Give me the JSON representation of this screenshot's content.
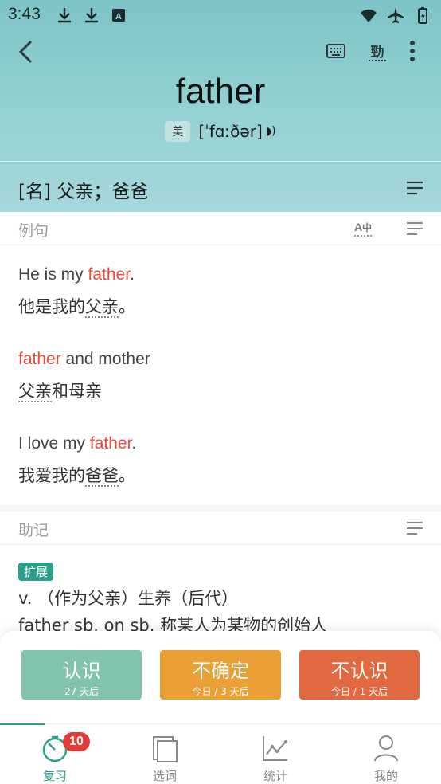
{
  "status": {
    "time": "3:43"
  },
  "word": {
    "text": "father",
    "region": "美",
    "phonetic": "[ˈfɑːðər]"
  },
  "definition": "[名] 父亲；爸爸",
  "examples_section": {
    "title": "例句",
    "items": [
      {
        "en_pre": "He is my ",
        "en_hl": "father",
        "en_post": ".",
        "zh_pre": "他是我的",
        "zh_u": "父亲",
        "zh_post": "。"
      },
      {
        "en_pre": "",
        "en_hl": "father",
        "en_post": " and mother",
        "zh_pre": "",
        "zh_u": "父亲",
        "zh_post": "和母亲"
      },
      {
        "en_pre": "I love my ",
        "en_hl": "father",
        "en_post": ".",
        "zh_pre": "我爱我的",
        "zh_u": "爸爸",
        "zh_post": "。"
      }
    ]
  },
  "mnemonic_section": {
    "title": "助记",
    "tag": "扩展",
    "line1": "v. （作为父亲）生养（后代）",
    "line2": "father sb. on sb. 称某人为某物的创始人"
  },
  "actions": {
    "know": {
      "label": "认识",
      "sub": "27 天后",
      "color": "#82c3ad"
    },
    "unsure": {
      "label": "不确定",
      "sub": "今日 / 3 天后",
      "color": "#eba036"
    },
    "unknown": {
      "label": "不认识",
      "sub": "今日 / 1 天后",
      "color": "#e2693f"
    }
  },
  "nav": {
    "review": {
      "label": "复习",
      "badge": "10"
    },
    "select": {
      "label": "选词"
    },
    "stats": {
      "label": "统计"
    },
    "mine": {
      "label": "我的"
    }
  },
  "colors": {
    "accent": "#2aa08c",
    "highlight": "#e84a3c",
    "header": "#8fcfd0"
  }
}
